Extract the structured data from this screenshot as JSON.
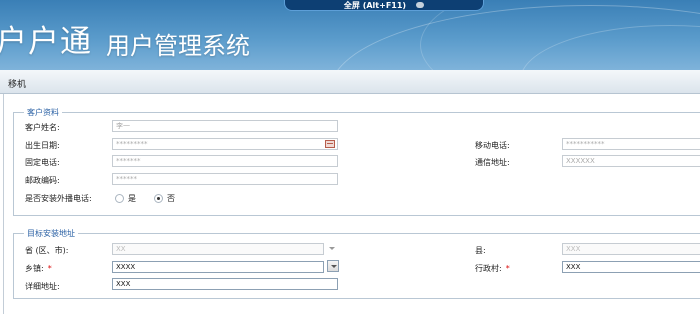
{
  "header": {
    "brand": "户户通",
    "subtitle": "用户管理系统",
    "fullscreen_label": "全屏 (Alt+F11)"
  },
  "panel": {
    "title": "移机"
  },
  "customer": {
    "legend": "客户资料",
    "name": {
      "label": "客户姓名:",
      "placeholder": "李一"
    },
    "birth": {
      "label": "出生日期:",
      "placeholder": "*********"
    },
    "mobile": {
      "label": "移动电话:",
      "placeholder": "***********"
    },
    "landline": {
      "label": "固定电话:",
      "placeholder": "*******"
    },
    "address": {
      "label": "通信地址:",
      "placeholder": "XXXXXX"
    },
    "postcode": {
      "label": "邮政编码:",
      "placeholder": "******"
    },
    "external_speaker": {
      "label": "是否安装外播电话:",
      "yes": "是",
      "no": "否",
      "selected": "否"
    }
  },
  "target": {
    "legend": "目标安装地址",
    "province": {
      "label": "省 (区、市):",
      "value": "XX"
    },
    "county": {
      "label": "县:",
      "value": "XXX"
    },
    "town": {
      "label": "乡镇:",
      "required_mark": "*",
      "value": "XXXX"
    },
    "village": {
      "label": "行政村:",
      "required_mark": "*",
      "value": "XXX"
    },
    "detail": {
      "label": "详细地址:",
      "value": "XXX"
    }
  },
  "icons": {
    "calendar": "calendar-icon",
    "dropdown": "chevron-down-icon"
  }
}
